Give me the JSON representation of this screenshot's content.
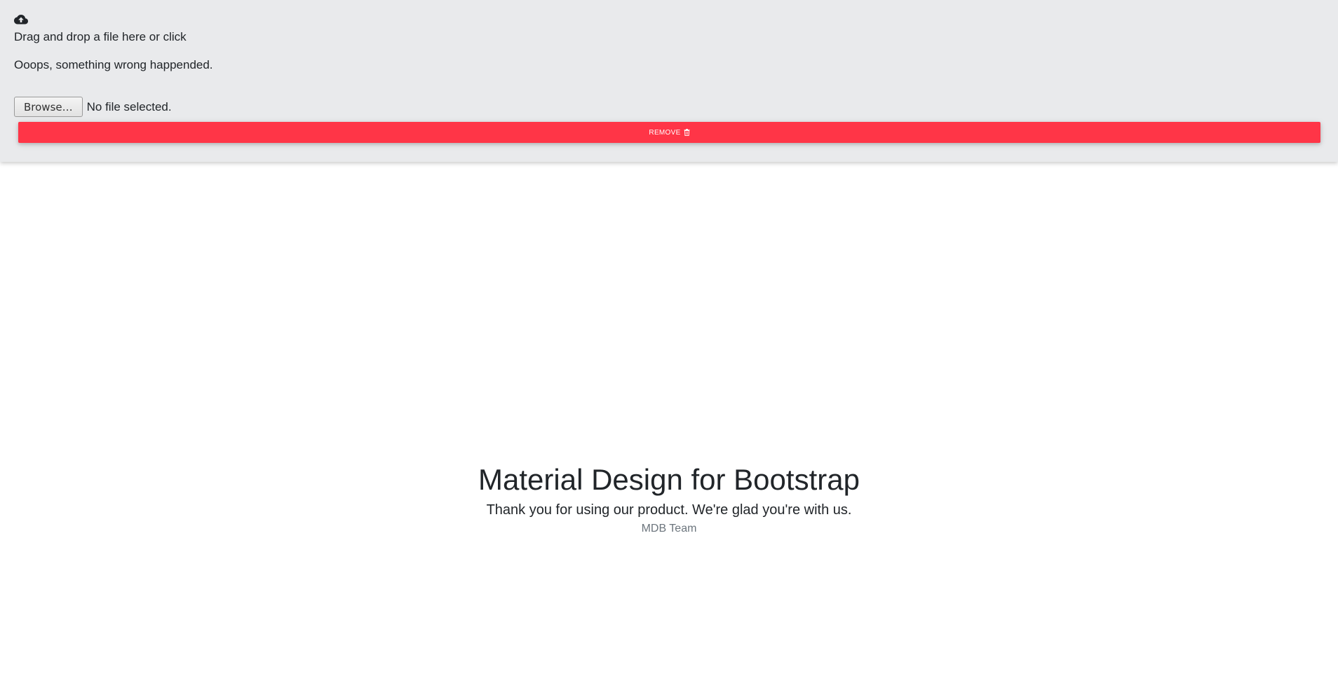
{
  "dropzone": {
    "icon": "cloud-upload-icon",
    "instruction": "Drag and drop a file here or click",
    "error_message": "Ooops, something wrong happended.",
    "browse_label": "Browse…",
    "file_status": "No file selected.",
    "remove_label": "REMOVE",
    "remove_icon": "trash-icon",
    "background_color": "#e9eaec",
    "remove_color": "#ff3547"
  },
  "hero": {
    "title": "Material Design for Bootstrap",
    "subtitle": "Thank you for using our product. We're glad you're with us.",
    "team": "MDB Team"
  }
}
